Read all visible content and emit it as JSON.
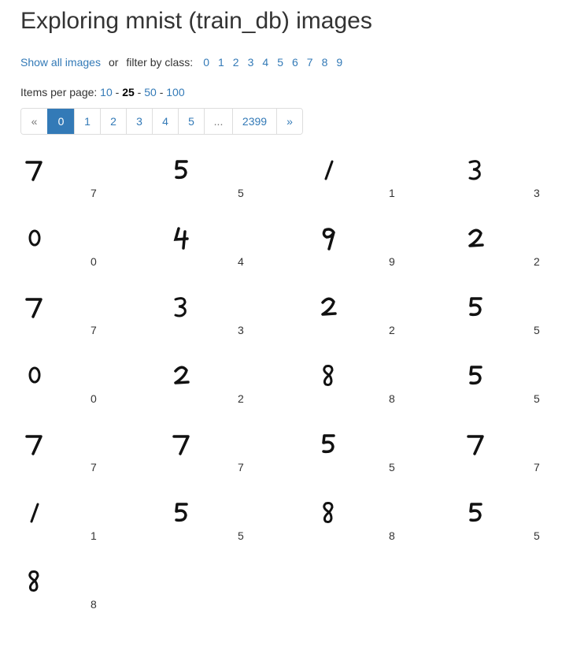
{
  "title": "Exploring mnist (train_db) images",
  "filter": {
    "show_all_label": "Show all images",
    "or_label": "or",
    "filter_label": "filter by class:",
    "classes": [
      "0",
      "1",
      "2",
      "3",
      "4",
      "5",
      "6",
      "7",
      "8",
      "9"
    ]
  },
  "per_page": {
    "label": "Items per page:",
    "options": [
      "10",
      "25",
      "50",
      "100"
    ],
    "selected": "25",
    "separator": "-"
  },
  "pagination": {
    "prev": "«",
    "pages": [
      "0",
      "1",
      "2",
      "3",
      "4",
      "5"
    ],
    "active": "0",
    "ellipsis": "...",
    "last": "2399",
    "next": "»"
  },
  "images": [
    {
      "label": "7"
    },
    {
      "label": "5"
    },
    {
      "label": "1"
    },
    {
      "label": "3"
    },
    {
      "label": "0"
    },
    {
      "label": "4"
    },
    {
      "label": "9"
    },
    {
      "label": "2"
    },
    {
      "label": "7"
    },
    {
      "label": "3"
    },
    {
      "label": "2"
    },
    {
      "label": "5"
    },
    {
      "label": "0"
    },
    {
      "label": "2"
    },
    {
      "label": "8"
    },
    {
      "label": "5"
    },
    {
      "label": "7"
    },
    {
      "label": "7"
    },
    {
      "label": "5"
    },
    {
      "label": "7"
    },
    {
      "label": "1"
    },
    {
      "label": "5"
    },
    {
      "label": "8"
    },
    {
      "label": "5"
    },
    {
      "label": "8"
    }
  ]
}
